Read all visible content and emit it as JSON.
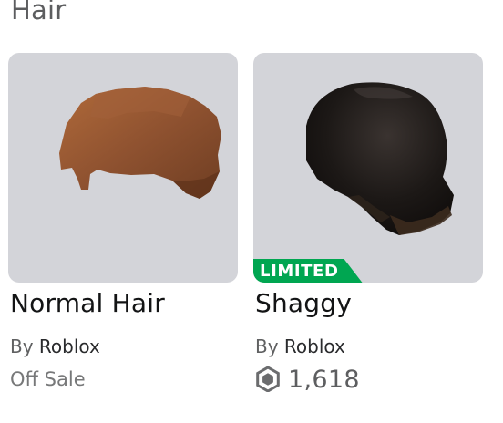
{
  "section": {
    "title": "Hair"
  },
  "items": [
    {
      "name": "Normal Hair",
      "creator_prefix": "By",
      "creator": "Roblox",
      "price_text": "Off Sale",
      "hair_color": "#8a4e2a",
      "background_color": "#d3d4d9"
    },
    {
      "name": "Shaggy",
      "creator_prefix": "By",
      "creator": "Roblox",
      "badge": "LIMITED",
      "badge_color": "#00a651",
      "price_icon": "robux-icon",
      "price_robux": "1,618",
      "hair_color": "#1c1816",
      "background_color": "#d3d4d9"
    }
  ]
}
